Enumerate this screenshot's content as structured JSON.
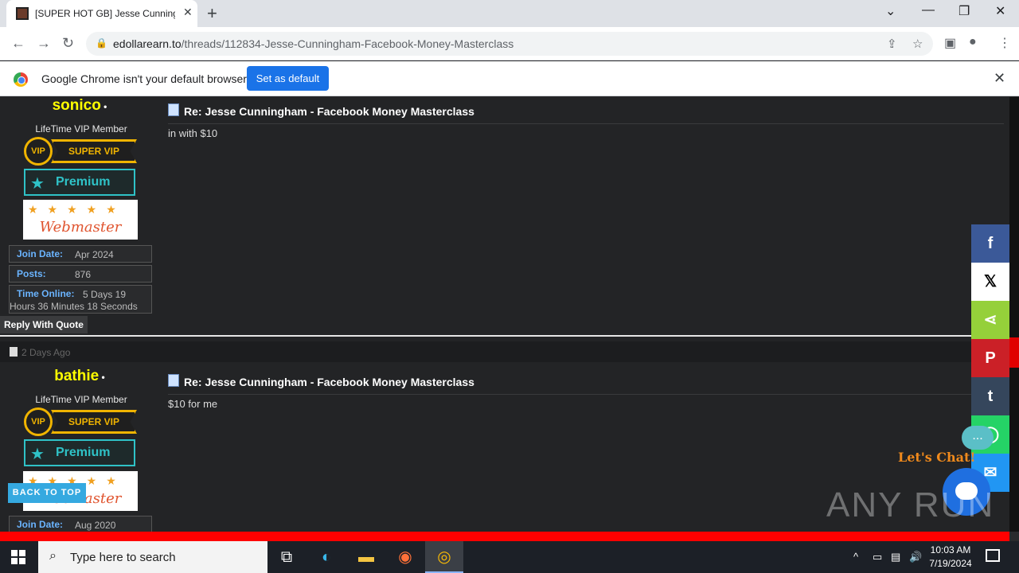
{
  "browser": {
    "tab_title": "[SUPER HOT GB] Jesse Cunningh",
    "url_domain": "edollarearn.to",
    "url_path": "/threads/112834-Jesse-Cunningham-Facebook-Money-Masterclass",
    "infobar_message": "Google Chrome isn't your default browser",
    "infobar_button": "Set as default"
  },
  "posts": [
    {
      "username": "sonico",
      "user_title": "LifeTime VIP Member",
      "vip_circle": "VIP",
      "vip_ribbon": "SUPER VIP",
      "premium_label": "Premium",
      "webmaster_label": "Webmaster",
      "join_date_label": "Join Date:",
      "join_date": "Apr 2024",
      "posts_label": "Posts:",
      "posts": "876",
      "time_online_label": "Time Online:",
      "time_online_1": "5 Days 19",
      "time_online_2": "Hours 36 Minutes 18 Seconds",
      "reply_with_quote": "Reply With Quote",
      "title": "Re: Jesse Cunningham - Facebook Money Masterclass",
      "body": "in with $10"
    },
    {
      "date": "2 Days Ago",
      "username": "bathie",
      "user_title": "LifeTime VIP Member",
      "vip_circle": "VIP",
      "vip_ribbon": "SUPER VIP",
      "premium_label": "Premium",
      "webmaster_label": "Webmaster",
      "join_date_label": "Join Date:",
      "join_date": "Aug 2020",
      "title": "Re: Jesse Cunningham - Facebook Money Masterclass",
      "body": "$10 for me"
    }
  ],
  "share": [
    {
      "icon": "facebook-icon",
      "glyph": "f",
      "color": "#3b5998"
    },
    {
      "icon": "x-icon",
      "glyph": "𝕏",
      "color": "#ffffff"
    },
    {
      "icon": "share-icon",
      "glyph": "⋖",
      "color": "#95d03a"
    },
    {
      "icon": "pinterest-icon",
      "glyph": "P",
      "color": "#cb2027"
    },
    {
      "icon": "tumblr-icon",
      "glyph": "t",
      "color": "#35465c"
    },
    {
      "icon": "whatsapp-icon",
      "glyph": "◯",
      "color": "#25d366"
    },
    {
      "icon": "messenger-icon",
      "glyph": "✉",
      "color": "#2196f3"
    }
  ],
  "back_to_top": "BACK TO TOP",
  "lets_chat": "Let's Chat!",
  "chat_dots": "...",
  "watermark": "ANY RUN",
  "taskbar": {
    "search_placeholder": "Type here to search",
    "time": "10:03 AM",
    "date": "7/19/2024"
  }
}
